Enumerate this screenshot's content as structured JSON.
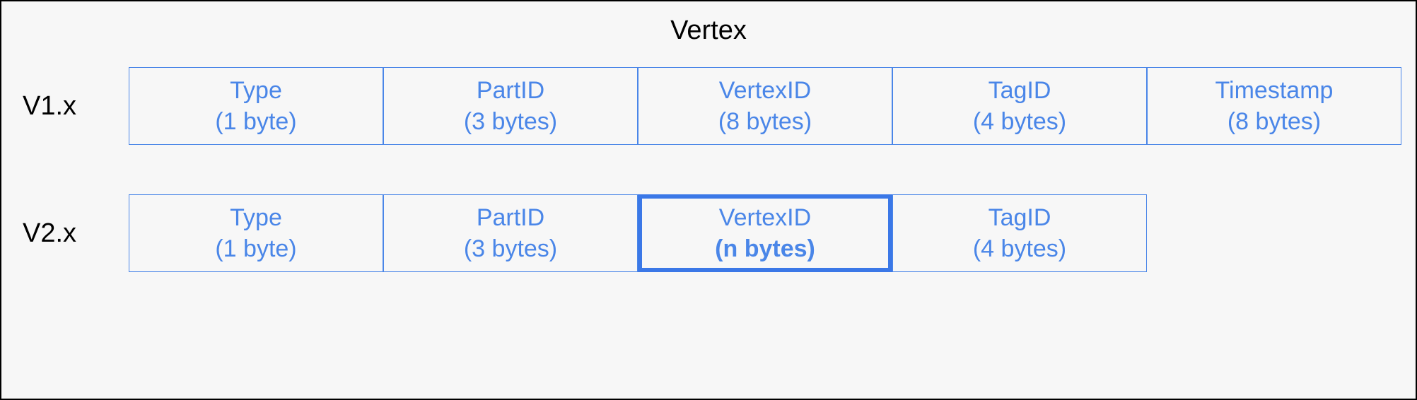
{
  "title": "Vertex",
  "rows": [
    {
      "label": "V1.x",
      "cells": [
        {
          "name": "Type",
          "size": "(1 byte)",
          "highlight": false
        },
        {
          "name": "PartID",
          "size": "(3 bytes)",
          "highlight": false
        },
        {
          "name": "VertexID",
          "size": "(8 bytes)",
          "highlight": false
        },
        {
          "name": "TagID",
          "size": "(4 bytes)",
          "highlight": false
        },
        {
          "name": "Timestamp",
          "size": "(8 bytes)",
          "highlight": false
        }
      ]
    },
    {
      "label": "V2.x",
      "cells": [
        {
          "name": "Type",
          "size": "(1 byte)",
          "highlight": false
        },
        {
          "name": "PartID",
          "size": "(3 bytes)",
          "highlight": false
        },
        {
          "name": "VertexID",
          "size": "(n bytes)",
          "highlight": true
        },
        {
          "name": "TagID",
          "size": "(4 bytes)",
          "highlight": false
        }
      ]
    }
  ]
}
